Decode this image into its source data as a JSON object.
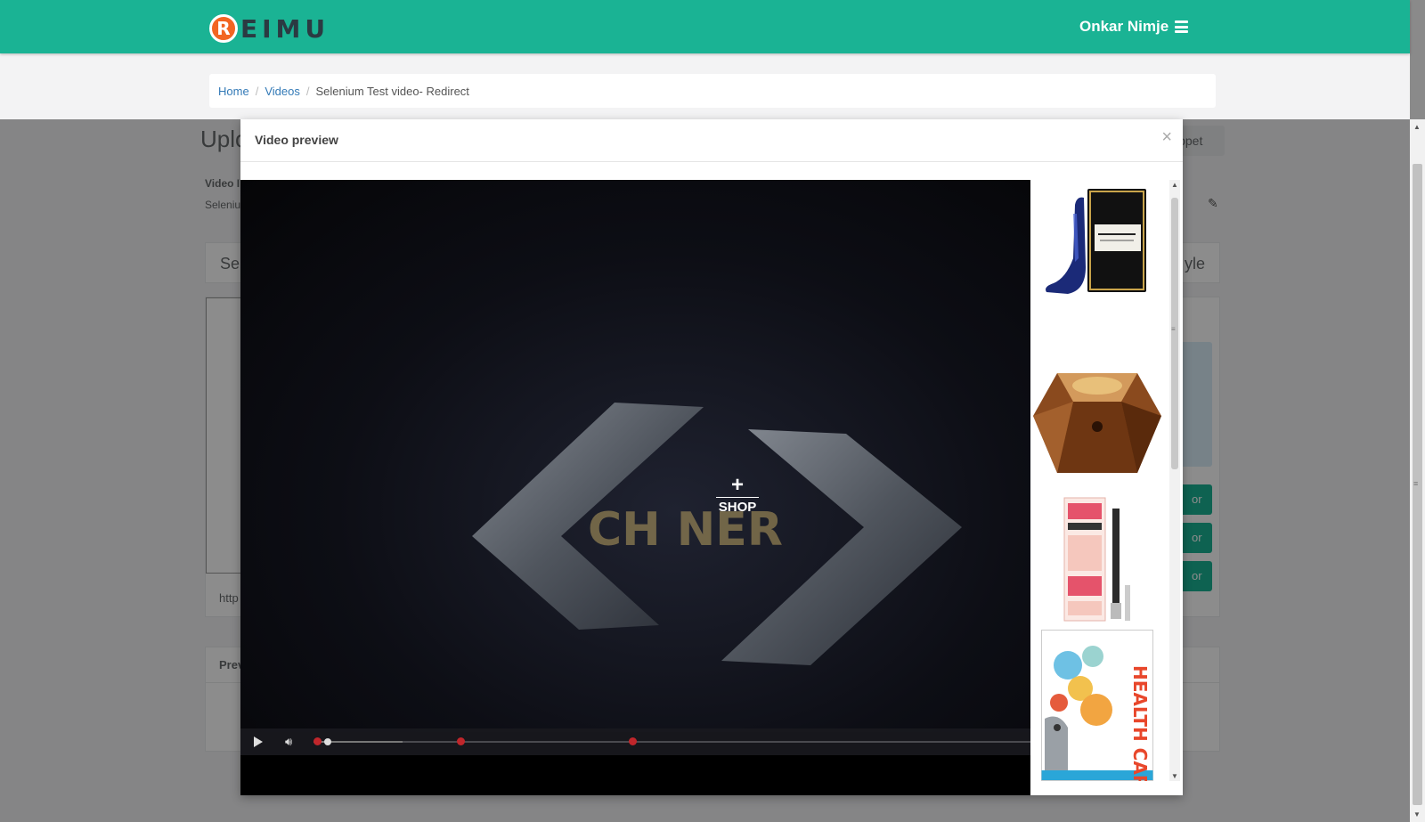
{
  "navbar": {
    "logo_letter": "R",
    "logo_text": "EIMU",
    "user_name": "Onkar Nimje",
    "menu_icon": "hamburger-icon"
  },
  "breadcrumb": {
    "items": [
      "Home",
      "Videos"
    ],
    "current": "Selenium Test video- Redirect"
  },
  "background": {
    "title": "Uplo",
    "snippet_button": "ippet",
    "video_label": "Video I",
    "video_value": "Seleniu",
    "panel_left": "Sel",
    "panel_right": "yle",
    "url_fragment": "http",
    "button_fragment": "or",
    "preview_label": "Prev"
  },
  "modal": {
    "title": "Video preview",
    "close_symbol": "×"
  },
  "player": {
    "overlay_plus": "+",
    "overlay_label": "SHOP",
    "video_text": "CH NER",
    "progress_fraction": 0.01,
    "markers_fraction": [
      0.0,
      0.2,
      0.44
    ],
    "colors": {
      "marker": "#c0262b",
      "control_bar": "#19191e"
    }
  },
  "products": [
    {
      "name": "Good Girl perfume",
      "icon": "perfume-bottle-icon"
    },
    {
      "name": "Lady Million perfume",
      "icon": "perfume-bottle-icon"
    },
    {
      "name": "Brow pencil",
      "icon": "makeup-pencil-icon"
    },
    {
      "name": "Health Care poster",
      "icon": "poster-icon",
      "text": "HEALTH CARE"
    }
  ],
  "colors": {
    "brand": "#1ab394",
    "link": "#337ab7"
  }
}
